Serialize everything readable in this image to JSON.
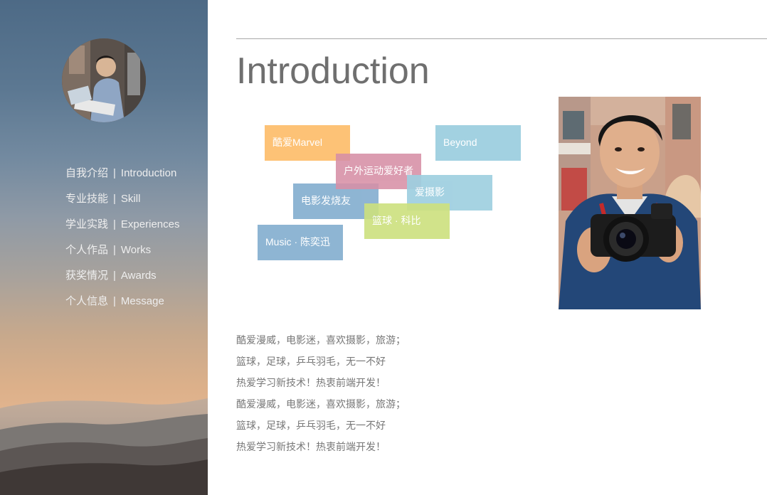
{
  "sidebar": {
    "avatar_alt": "avatar",
    "nav": [
      {
        "cn": "自我介绍",
        "en": "Introduction"
      },
      {
        "cn": "专业技能",
        "en": "Skill"
      },
      {
        "cn": "学业实践",
        "en": "Experiences"
      },
      {
        "cn": "个人作品",
        "en": "Works"
      },
      {
        "cn": "获奖情况",
        "en": "Awards"
      },
      {
        "cn": "个人信息",
        "en": "Message"
      }
    ],
    "separator": "|"
  },
  "main": {
    "title": "Introduction",
    "tags": [
      {
        "label": "酷爱Marvel",
        "color": "#fdbf6f"
      },
      {
        "label": "Beyond",
        "color": "#9ecfe0"
      },
      {
        "label": "户外运动爱好者",
        "color": "#d78fa6"
      },
      {
        "label": "电影发烧友",
        "color": "#85afd0"
      },
      {
        "label": "爱摄影",
        "color": "#9ecfe0"
      },
      {
        "label": "篮球 · 科比",
        "color": "#cde17e"
      },
      {
        "label": "Music · 陈奕迅",
        "color": "#85afd0"
      }
    ],
    "bio": [
      "酷爱漫威，电影迷，喜欢摄影，旅游；",
      "篮球，足球，乒乓羽毛，无一不好",
      "热爱学习新技术！热衷前端开发！",
      "酷爱漫威，电影迷，喜欢摄影，旅游；",
      "篮球，足球，乒乓羽毛，无一不好",
      "热爱学习新技术！热衷前端开发！"
    ]
  }
}
